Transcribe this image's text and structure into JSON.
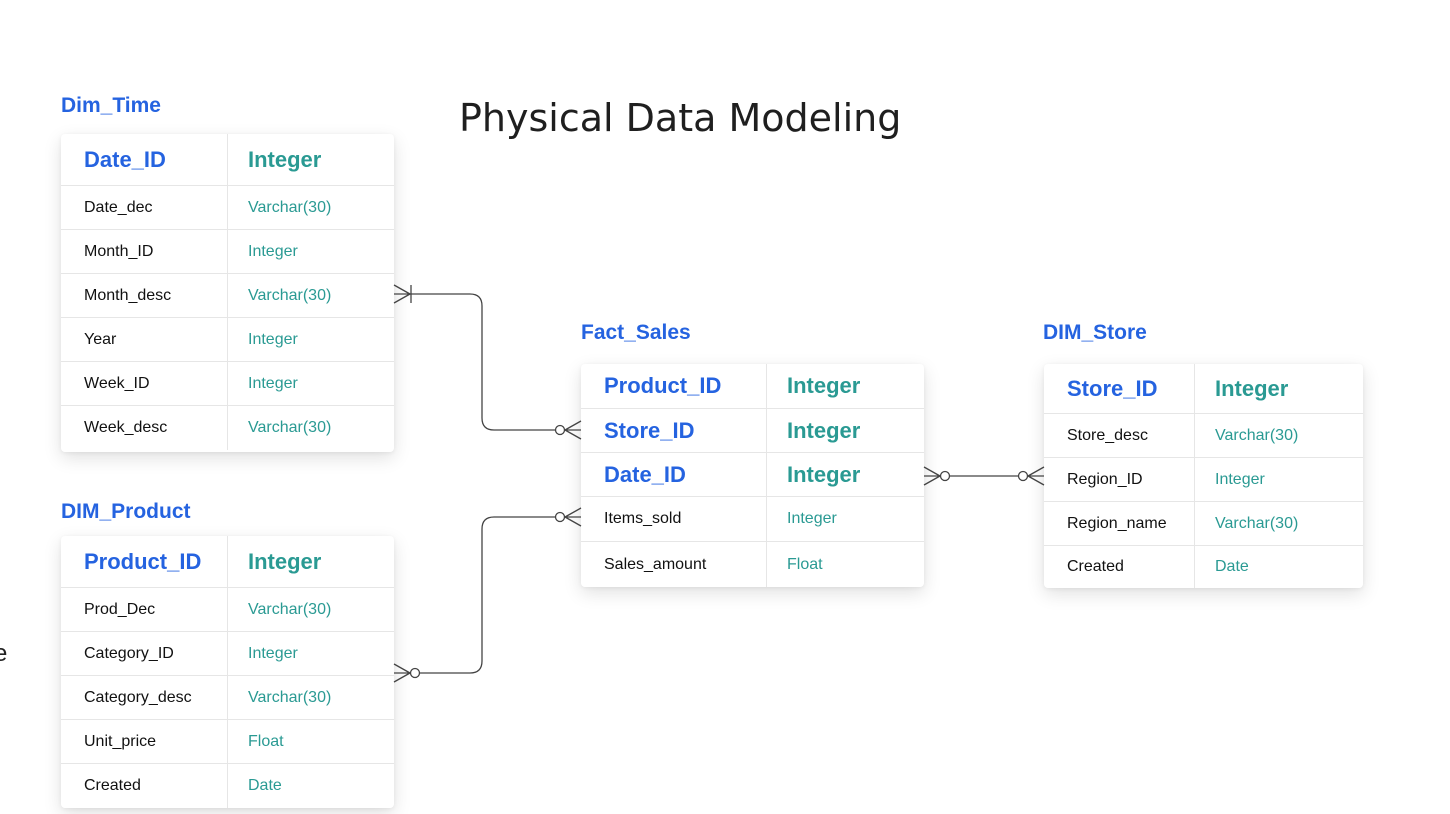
{
  "title": "Physical Data Modeling",
  "edge_fragment": "e",
  "tables": {
    "dim_time": {
      "label": "Dim_Time",
      "key": {
        "name": "Date_ID",
        "type": "Integer"
      },
      "rows": [
        {
          "name": "Date_dec",
          "type": "Varchar(30)"
        },
        {
          "name": "Month_ID",
          "type": "Integer"
        },
        {
          "name": "Month_desc",
          "type": "Varchar(30)"
        },
        {
          "name": "Year",
          "type": "Integer"
        },
        {
          "name": "Week_ID",
          "type": "Integer"
        },
        {
          "name": "Week_desc",
          "type": "Varchar(30)"
        }
      ]
    },
    "dim_product": {
      "label": "DIM_Product",
      "key": {
        "name": "Product_ID",
        "type": "Integer"
      },
      "rows": [
        {
          "name": "Prod_Dec",
          "type": "Varchar(30)"
        },
        {
          "name": "Category_ID",
          "type": "Integer"
        },
        {
          "name": "Category_desc",
          "type": "Varchar(30)"
        },
        {
          "name": "Unit_price",
          "type": "Float"
        },
        {
          "name": "Created",
          "type": "Date"
        }
      ]
    },
    "fact_sales": {
      "label": "Fact_Sales",
      "keys": [
        {
          "name": "Product_ID",
          "type": "Integer"
        },
        {
          "name": "Store_ID",
          "type": "Integer"
        },
        {
          "name": "Date_ID",
          "type": "Integer"
        }
      ],
      "rows": [
        {
          "name": "Items_sold",
          "type": "Integer"
        },
        {
          "name": "Sales_amount",
          "type": "Float"
        }
      ]
    },
    "dim_store": {
      "label": "DIM_Store",
      "key": {
        "name": "Store_ID",
        "type": "Integer"
      },
      "rows": [
        {
          "name": "Store_desc",
          "type": "Varchar(30)"
        },
        {
          "name": "Region_ID",
          "type": "Integer"
        },
        {
          "name": "Region_name",
          "type": "Varchar(30)"
        },
        {
          "name": "Created",
          "type": "Date"
        }
      ]
    }
  },
  "colors": {
    "key_name": "#2563e0",
    "type": "#2a9a93",
    "line": "#444444"
  }
}
